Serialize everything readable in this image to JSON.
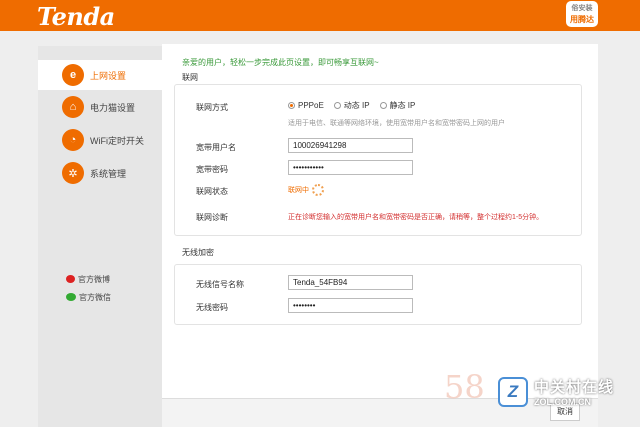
{
  "header": {
    "logo": "Tenda",
    "badge_line1": "俗安装",
    "badge_line2": "用腾达"
  },
  "sidebar": {
    "items": [
      {
        "label": "上网设置",
        "icon": "e"
      },
      {
        "label": "电力猫设置",
        "icon": "⌂"
      },
      {
        "label": "WiFi定时开关",
        "icon": "◔"
      },
      {
        "label": "系统管理",
        "icon": "✲"
      }
    ],
    "links": [
      {
        "label": "官方微博"
      },
      {
        "label": "官方微信"
      }
    ]
  },
  "main": {
    "welcome": "亲爱的用户，轻松一步完成此页设置，即可畅享互联网~",
    "internet": {
      "section_title": "联网",
      "mode_label": "联网方式",
      "modes": [
        "PPPoE",
        "动态 IP",
        "静态 IP"
      ],
      "hint": "适用于电信、联通等网络环境，使用宽带用户名和宽带密码上网的用户",
      "username_label": "宽带用户名",
      "username_value": "100026941298",
      "password_label": "宽带密码",
      "password_value": "•••••••••••",
      "status_label": "联网状态",
      "status_value": "联网中",
      "diag_label": "联网诊断",
      "diag_value": "正在诊断您输入的宽带用户名和宽带密码是否正确，请稍等，整个过程约1-5分钟。"
    },
    "wireless": {
      "section_title": "无线加密",
      "ssid_label": "无线信号名称",
      "ssid_value": "Tenda_54FB94",
      "password_label": "无线密码",
      "password_value": "••••••••"
    }
  },
  "footer": {
    "watermark": "58",
    "zol_logo": "Z",
    "zol_name": "中关村在线",
    "zol_url": "ZOL.COM.CN",
    "button_label": "取消"
  }
}
